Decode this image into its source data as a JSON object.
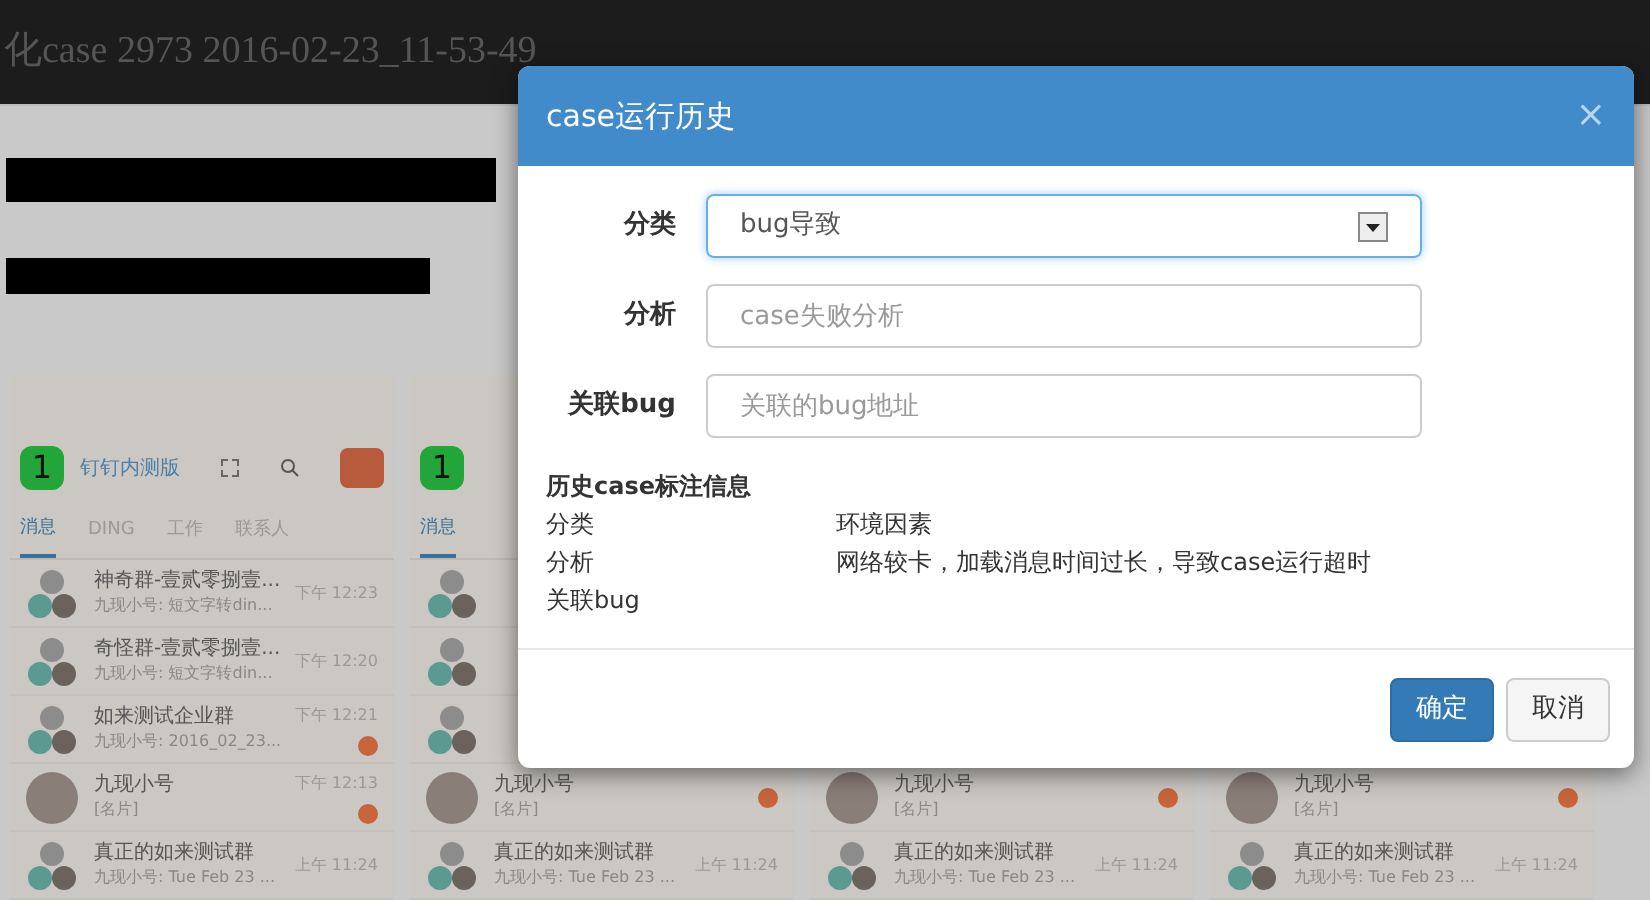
{
  "page_title": "化case  2973  2016-02-23_11-53-49",
  "phones": [
    {
      "header": {
        "badge": "1",
        "app_name": "钉钉内测版"
      },
      "tabs": [
        {
          "label": "消息",
          "selected": true
        },
        {
          "label": "DING",
          "selected": false
        },
        {
          "label": "工作",
          "selected": false
        },
        {
          "label": "联系人",
          "selected": false
        }
      ],
      "items": [
        {
          "title": "神奇群-壹贰零捌壹...",
          "subtitle": "九现小号: 短文字转din...",
          "time": "下午 12:23",
          "unread": false,
          "kind": "group"
        },
        {
          "title": "奇怪群-壹贰零捌壹...",
          "subtitle": "九现小号: 短文字转din...",
          "time": "下午 12:20",
          "unread": false,
          "kind": "group"
        },
        {
          "title": "如来测试企业群",
          "subtitle": "九现小号: 2016_02_23...",
          "time": "下午 12:21",
          "unread": true,
          "kind": "group"
        },
        {
          "title": "九现小号",
          "subtitle": "[名片]",
          "time": "下午 12:13",
          "unread": true,
          "kind": "single"
        },
        {
          "title": "真正的如来测试群",
          "subtitle": "九现小号: Tue Feb 23 ...",
          "time": "上午 11:24",
          "unread": false,
          "kind": "group"
        }
      ]
    },
    {
      "header": {
        "badge": "1"
      },
      "tabs": [
        {
          "label": "消息",
          "selected": true
        }
      ],
      "items": [
        {
          "kind": "group"
        },
        {
          "kind": "group"
        },
        {
          "kind": "group"
        },
        {
          "title": "九现小号",
          "subtitle": "[名片]",
          "unread": true,
          "kind": "single"
        },
        {
          "title": "真正的如来测试群",
          "subtitle": "九现小号: Tue Feb 23 ...",
          "time": "上午 11:24",
          "unread": false,
          "kind": "group"
        }
      ]
    },
    {
      "items": [
        {
          "title": "九现小号",
          "subtitle": "[名片]",
          "unread": true,
          "kind": "single"
        },
        {
          "title": "真正的如来测试群",
          "subtitle": "九现小号: Tue Feb 23 ...",
          "time": "上午 11:24",
          "unread": false,
          "kind": "group"
        }
      ]
    },
    {
      "items": [
        {
          "title": "九现小号",
          "subtitle": "[名片]",
          "unread": true,
          "kind": "single"
        },
        {
          "title": "真正的如来测试群",
          "subtitle": "九现小号: Tue Feb 23 ...",
          "time": "上午 11:24",
          "unread": false,
          "kind": "group"
        }
      ]
    }
  ],
  "dialog": {
    "title": "case运行历史",
    "close": "×",
    "fields": [
      {
        "label": "分类",
        "kind": "select",
        "value": "bug导致"
      },
      {
        "label": "分析",
        "kind": "text",
        "placeholder": "case失败分析"
      },
      {
        "label": "关联bug",
        "kind": "text",
        "placeholder": "关联的bug地址"
      }
    ],
    "history": {
      "title": "历史case标注信息",
      "rows": [
        {
          "label": "分类",
          "value": "环境因素"
        },
        {
          "label": "分析",
          "value": "网络较卡，加载消息时间过长，导致case运行超时"
        },
        {
          "label": "关联bug"
        }
      ]
    },
    "buttons": [
      {
        "label": "确定",
        "kind": "primary"
      },
      {
        "label": "取消",
        "kind": "default"
      }
    ]
  }
}
